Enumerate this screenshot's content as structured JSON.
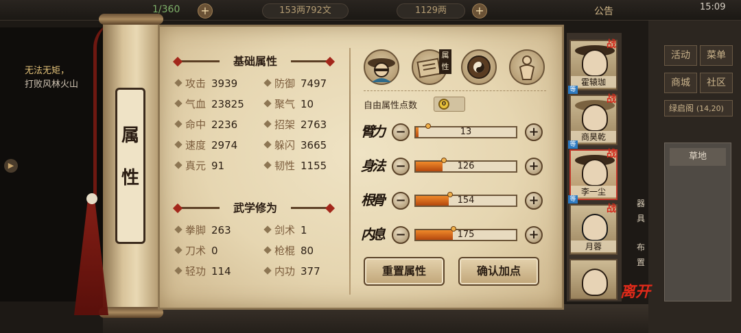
{
  "hud": {
    "energy": "1/360",
    "copper": "153两792文",
    "gold": "1129两",
    "announcement": "公告",
    "clock": "15:09"
  },
  "quest": {
    "title": "无法无矩，",
    "subtitle": "打败风林火山"
  },
  "scroll": {
    "tab_label": "属性"
  },
  "basic": {
    "title": "基础属性",
    "stats": [
      {
        "label": "攻击",
        "value": "3939"
      },
      {
        "label": "防御",
        "value": "7497"
      },
      {
        "label": "气血",
        "value": "23825"
      },
      {
        "label": "聚气",
        "value": "10"
      },
      {
        "label": "命中",
        "value": "2236"
      },
      {
        "label": "招架",
        "value": "2763"
      },
      {
        "label": "速度",
        "value": "2974"
      },
      {
        "label": "躲闪",
        "value": "3665"
      },
      {
        "label": "真元",
        "value": "91"
      },
      {
        "label": "韧性",
        "value": "1155"
      }
    ]
  },
  "martial": {
    "title": "武学修为",
    "stats": [
      {
        "label": "拳脚",
        "value": "263"
      },
      {
        "label": "剑术",
        "value": "1"
      },
      {
        "label": "刀术",
        "value": "0"
      },
      {
        "label": "枪棍",
        "value": "80"
      },
      {
        "label": "轻功",
        "value": "114"
      },
      {
        "label": "内功",
        "value": "377"
      }
    ]
  },
  "icons": {
    "tag": "属性",
    "items": [
      "character-portrait-icon",
      "scroll-book-icon",
      "bagua-icon",
      "meridian-body-icon"
    ]
  },
  "free_points": {
    "label": "自由属性点数",
    "value": "0"
  },
  "attributes": [
    {
      "name": "臂力",
      "value": "13",
      "fill": 0.03
    },
    {
      "name": "身法",
      "value": "126",
      "fill": 0.27
    },
    {
      "name": "根骨",
      "value": "154",
      "fill": 0.33
    },
    {
      "name": "内息",
      "value": "175",
      "fill": 0.37
    }
  ],
  "buttons": {
    "minus": "−",
    "plus": "+",
    "reset": "重置属性",
    "confirm": "确认加点"
  },
  "party": [
    {
      "name": "霍辕珈",
      "battle": "战"
    },
    {
      "name": "商昊乾",
      "battle": "战"
    },
    {
      "name": "李一尘",
      "battle": "战"
    },
    {
      "name": "月蓉",
      "battle": "战"
    },
    {
      "name": ""
    }
  ],
  "party_extra": {
    "leave": "离开",
    "equip": "器具",
    "layout": "布置"
  },
  "right_panel": {
    "btn1": "活动",
    "btn2": "菜单",
    "btn3": "商城",
    "btn4": "社区",
    "place": "绿启阁",
    "coords": "(14,20)",
    "terrain": "草地"
  },
  "colors": {
    "accent_red": "#a3271b",
    "bar_orange": "#e0782a",
    "parchment": "#e6d6b1"
  }
}
